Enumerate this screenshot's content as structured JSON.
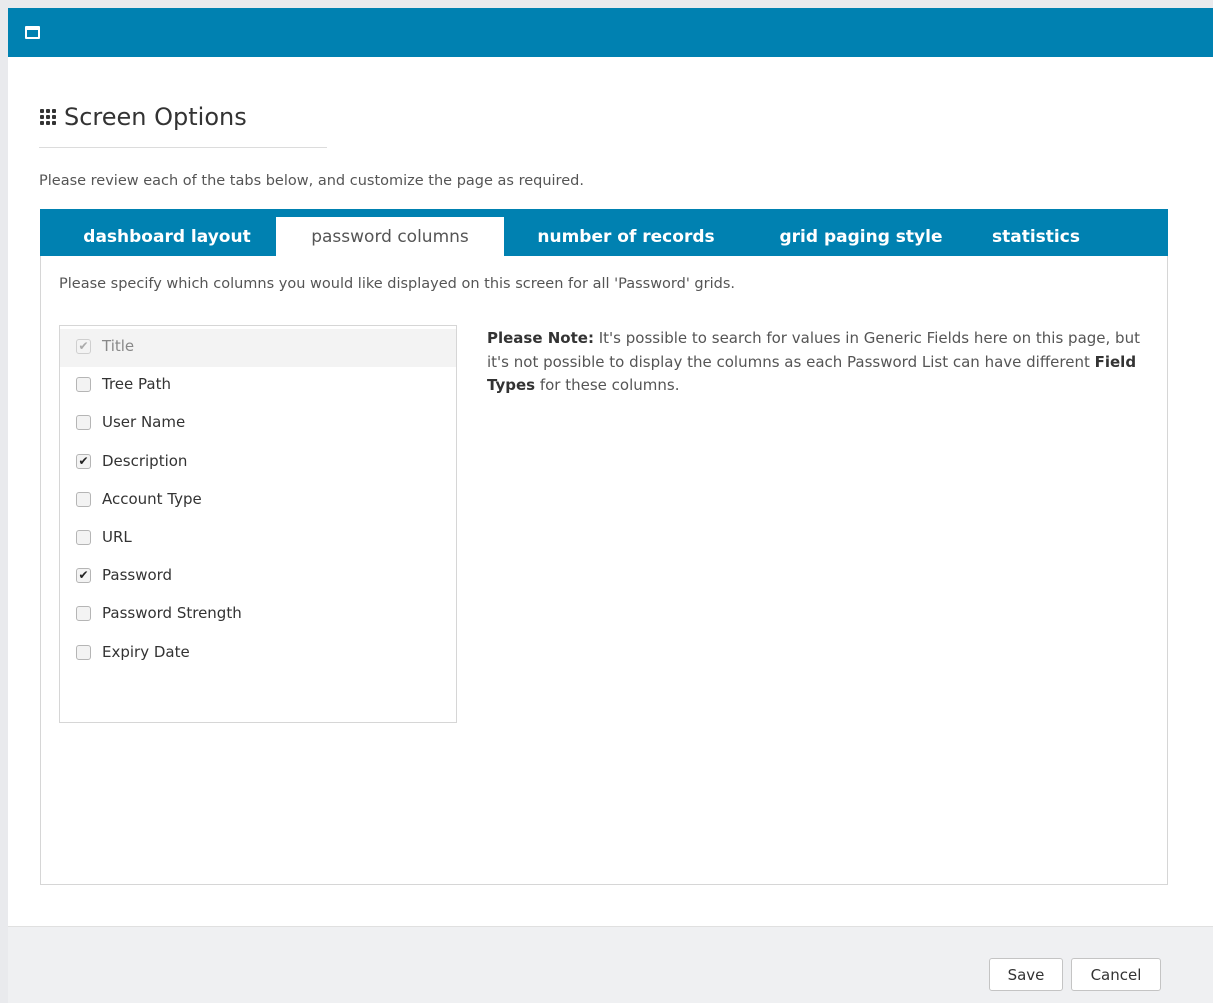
{
  "window": {
    "icon": "window-icon"
  },
  "header": {
    "icon": "grid-dots-icon",
    "title": "Screen Options"
  },
  "intro": "Please review each of the tabs below, and customize the page as required.",
  "tabs": [
    {
      "label": "dashboard layout",
      "active": false
    },
    {
      "label": "password columns",
      "active": true
    },
    {
      "label": "number of records",
      "active": false
    },
    {
      "label": "grid paging style",
      "active": false
    },
    {
      "label": "statistics",
      "active": false
    }
  ],
  "panel": {
    "description": "Please specify which columns you would like displayed on this screen for all 'Password' grids.",
    "columns": [
      {
        "label": "Title",
        "checked": true,
        "disabled": true
      },
      {
        "label": "Tree Path",
        "checked": false,
        "disabled": false
      },
      {
        "label": "User Name",
        "checked": false,
        "disabled": false
      },
      {
        "label": "Description",
        "checked": true,
        "disabled": false
      },
      {
        "label": "Account Type",
        "checked": false,
        "disabled": false
      },
      {
        "label": "URL",
        "checked": false,
        "disabled": false
      },
      {
        "label": "Password",
        "checked": true,
        "disabled": false
      },
      {
        "label": "Password Strength",
        "checked": false,
        "disabled": false
      },
      {
        "label": "Expiry Date",
        "checked": false,
        "disabled": false
      }
    ],
    "note": {
      "prefix": "Please Note:",
      "text1": " It's possible to search for values in Generic Fields here on this page, but it's not possible to display the columns as each Password List can have different ",
      "emphasis": "Field Types",
      "text2": " for these columns."
    }
  },
  "footer": {
    "save_label": "Save",
    "cancel_label": "Cancel"
  },
  "colors": {
    "accent": "#0081b1",
    "footer_bg": "#eff0f2"
  }
}
